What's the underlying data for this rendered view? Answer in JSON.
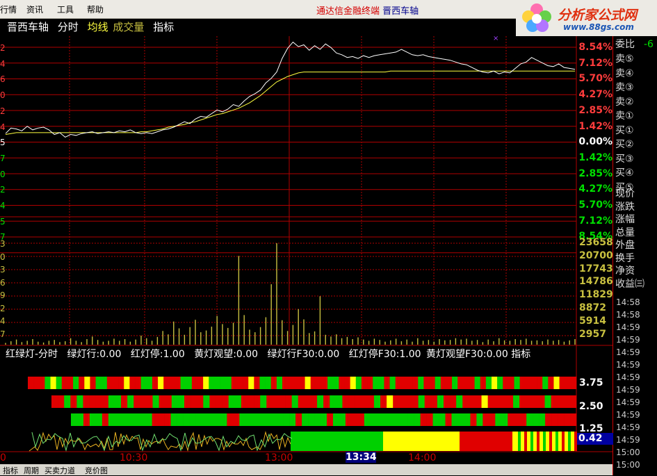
{
  "menubar": {
    "items": [
      "行情",
      "资讯",
      "工具",
      "帮助"
    ],
    "window_title": "通达信金融终端",
    "window_stock": "晋西车轴"
  },
  "logo": {
    "text": "分析家公式网",
    "url": "www.88gs.com"
  },
  "chart_header": {
    "stock_name": "晋西车轴",
    "mode": "分时",
    "avg_line": "均线",
    "volume": "成交量",
    "indicator": "指标"
  },
  "colors": {
    "up": "#ff3c3c",
    "down": "#00e000",
    "grid": "#b00000",
    "price_line": "#ffffff",
    "avg_line": "#ffff40",
    "volume": "#c8c040"
  },
  "price_axis_right": [
    {
      "text": "8.54%",
      "color": "up"
    },
    {
      "text": "7.12%",
      "color": "up"
    },
    {
      "text": "5.70%",
      "color": "up"
    },
    {
      "text": "4.27%",
      "color": "up"
    },
    {
      "text": "2.85%",
      "color": "up"
    },
    {
      "text": "1.42%",
      "color": "up"
    },
    {
      "text": "0.00%",
      "color": "flat"
    },
    {
      "text": "1.42%",
      "color": "down"
    },
    {
      "text": "2.85%",
      "color": "down"
    },
    {
      "text": "4.27%",
      "color": "down"
    },
    {
      "text": "5.70%",
      "color": "down"
    },
    {
      "text": "7.12%",
      "color": "down"
    },
    {
      "text": "8.54%",
      "color": "down"
    }
  ],
  "price_axis_left_partial": [
    "2",
    "4",
    "6",
    "0",
    "2",
    "4",
    "5",
    "7",
    "0",
    "2",
    "4",
    "5",
    "7"
  ],
  "volume_axis": [
    "23658",
    "20700",
    "17743",
    "14786",
    "11829",
    "8872",
    "5914",
    "2957"
  ],
  "volume_axis_left_partial": [
    "3",
    "0",
    "3",
    "6",
    "9",
    "2",
    "4",
    "7"
  ],
  "right_panel": {
    "weibi_label": "委比",
    "weibi_value": "-6",
    "order_book": [
      "卖⑤",
      "卖④",
      "卖③",
      "卖②",
      "卖①",
      "买①",
      "买②",
      "买③",
      "买④",
      "买⑤"
    ],
    "stats": [
      "现价",
      "涨跌",
      "涨幅",
      "总量",
      "外盘",
      "换手",
      "净资",
      "收益㈢"
    ],
    "ticks": [
      "14:58",
      "14:58",
      "14:59",
      "14:59",
      "14:59",
      "14:59",
      "14:59",
      "14:59",
      "14:59",
      "14:59",
      "14:59",
      "14:59",
      "15:00",
      "15:00"
    ]
  },
  "indicator": {
    "name": "红绿灯-分时",
    "params": [
      "绿灯行:0.00",
      "红灯停:1.00",
      "黄灯观望:0.00",
      "绿灯行F30:0.00",
      "红灯停F30:1.00",
      "黄灯观望F30:0.00 指标"
    ],
    "levels": [
      "3.75",
      "2.50",
      "1.25"
    ],
    "current_value": "0.42"
  },
  "x_axis": {
    "labels": [
      "0",
      "10:30",
      "13:00",
      "14:00"
    ],
    "cursor_time": "13:34"
  },
  "bottom_tabs": [
    "指标",
    "周期",
    "买卖力道",
    "竞价图"
  ],
  "chart_data": {
    "type": "line",
    "x_label": "time",
    "price_pct": [
      0.2,
      0.8,
      0.7,
      0.5,
      1.0,
      0.6,
      0.8,
      0.9,
      0.6,
      0.1,
      0.3,
      -0.2,
      0.1,
      0.0,
      0.2,
      0.3,
      0.4,
      0.2,
      0.3,
      0.4,
      0.3,
      0.5,
      0.4,
      0.6,
      0.3,
      0.2,
      0.3,
      0.2,
      0.4,
      0.6,
      0.7,
      0.9,
      1.2,
      1.5,
      1.3,
      1.8,
      2.1,
      2.0,
      2.4,
      2.8,
      2.6,
      2.9,
      3.4,
      3.2,
      3.8,
      4.3,
      4.6,
      5.0,
      5.8,
      6.3,
      7.0,
      8.5,
      9.6,
      10.3,
      9.8,
      10.0,
      9.4,
      9.9,
      9.5,
      10.1,
      9.7,
      9.1,
      8.9,
      8.6,
      8.7,
      8.5,
      8.8,
      8.6,
      8.8,
      8.9,
      9.0,
      9.1,
      9.2,
      9.5,
      9.2,
      8.9,
      8.8,
      8.9,
      8.7,
      8.6,
      8.5,
      8.4,
      8.3,
      8.1,
      7.9,
      7.8,
      7.5,
      7.2,
      7.0,
      6.9,
      7.1,
      6.8,
      7.0,
      6.9,
      7.4,
      7.9,
      8.1,
      8.6,
      8.3,
      8.0,
      7.7,
      7.6,
      7.9,
      7.5,
      7.4,
      7.3
    ],
    "avg_pct": [
      0.1,
      0.2,
      0.3,
      0.3,
      0.3,
      0.3,
      0.3,
      0.3,
      0.3,
      0.3,
      0.3,
      0.3,
      0.3,
      0.3,
      0.3,
      0.3,
      0.3,
      0.3,
      0.3,
      0.3,
      0.3,
      0.3,
      0.3,
      0.3,
      0.3,
      0.4,
      0.4,
      0.5,
      0.6,
      0.7,
      0.9,
      1.0,
      1.1,
      1.2,
      1.4,
      1.5,
      1.7,
      1.9,
      2.1,
      2.3,
      2.4,
      2.6,
      2.8,
      3.0,
      3.3,
      3.6,
      4.0,
      4.4,
      4.9,
      5.4,
      5.9,
      6.2,
      6.5,
      6.7,
      6.9,
      7.0,
      7.0,
      7.0,
      7.0,
      7.0,
      7.0,
      7.0,
      7.0,
      7.0,
      7.0,
      7.0,
      7.0,
      7.0,
      7.0,
      7.0,
      7.0,
      7.1,
      7.1,
      7.1,
      7.1,
      7.1,
      7.1,
      7.1,
      7.1,
      7.1,
      7.1,
      7.1,
      7.1,
      7.1,
      7.1,
      7.1,
      7.1,
      7.1,
      7.1,
      7.1,
      7.1,
      7.1,
      7.1,
      7.1,
      7.1,
      7.1,
      7.1,
      7.1,
      7.1,
      7.1,
      7.1,
      7.1,
      7.1,
      7.1,
      7.1,
      7.1
    ],
    "volume": [
      400,
      800,
      1200,
      600,
      900,
      1300,
      700,
      500,
      900,
      1100,
      600,
      800,
      1500,
      900,
      600,
      1300,
      1900,
      1100,
      700,
      900,
      1400,
      900,
      1300,
      700,
      1200,
      2100,
      1500,
      900,
      1800,
      3200,
      2400,
      5400,
      3800,
      2300,
      4100,
      5800,
      2900,
      3300,
      4200,
      6700,
      4800,
      3900,
      5100,
      20700,
      6900,
      3500,
      2900,
      4100,
      6400,
      14100,
      23658,
      5700,
      3200,
      4600,
      8300,
      5900,
      2700,
      3100,
      11300,
      2300,
      1900,
      2400,
      1500,
      1800,
      1300,
      1700,
      1200,
      900,
      1400,
      1100,
      700,
      1000,
      1400,
      800,
      1200,
      700,
      1500,
      900,
      1100,
      700,
      1300,
      1000,
      1100,
      1500,
      1200,
      1400,
      900,
      1100,
      600,
      1200,
      800,
      1500,
      1000,
      900,
      1300,
      1100,
      1400,
      900,
      1000,
      800,
      1200,
      900,
      1100,
      700,
      1000,
      1300
    ],
    "y_range_pct": [
      -8.54,
      10.5
    ],
    "volume_max": 23658,
    "signal_rows": [
      {
        "level": "3.75",
        "pattern": "RRRGYGRRGRYRGGRRRYRRGGRYRRRGGRRYGGGGRRRYRGGRGRRRRYRRRGGRRYGRRGGRGRRRRGRRGRRGRRRGRGYGRRGRRRRGRYRRR"
      },
      {
        "level": "2.50",
        "pattern": "RRGRGRRRRGGRGRRRGRRGGRRRGRRRGGRRRGRRRRGRRRGRGGRRRRRGRYRRRRGRRGRRGRRRYRRRRGRRRRGRRRR"
      },
      {
        "level": "1.25",
        "pattern": "GGRGGRGGGGGGGRRRGGGGGGGGGRRGGGGGGGGGRGGGGRGGRRRGGGGGGGGGRRGGRGGGRGRRGGRRRGGGRRRRR"
      }
    ]
  }
}
